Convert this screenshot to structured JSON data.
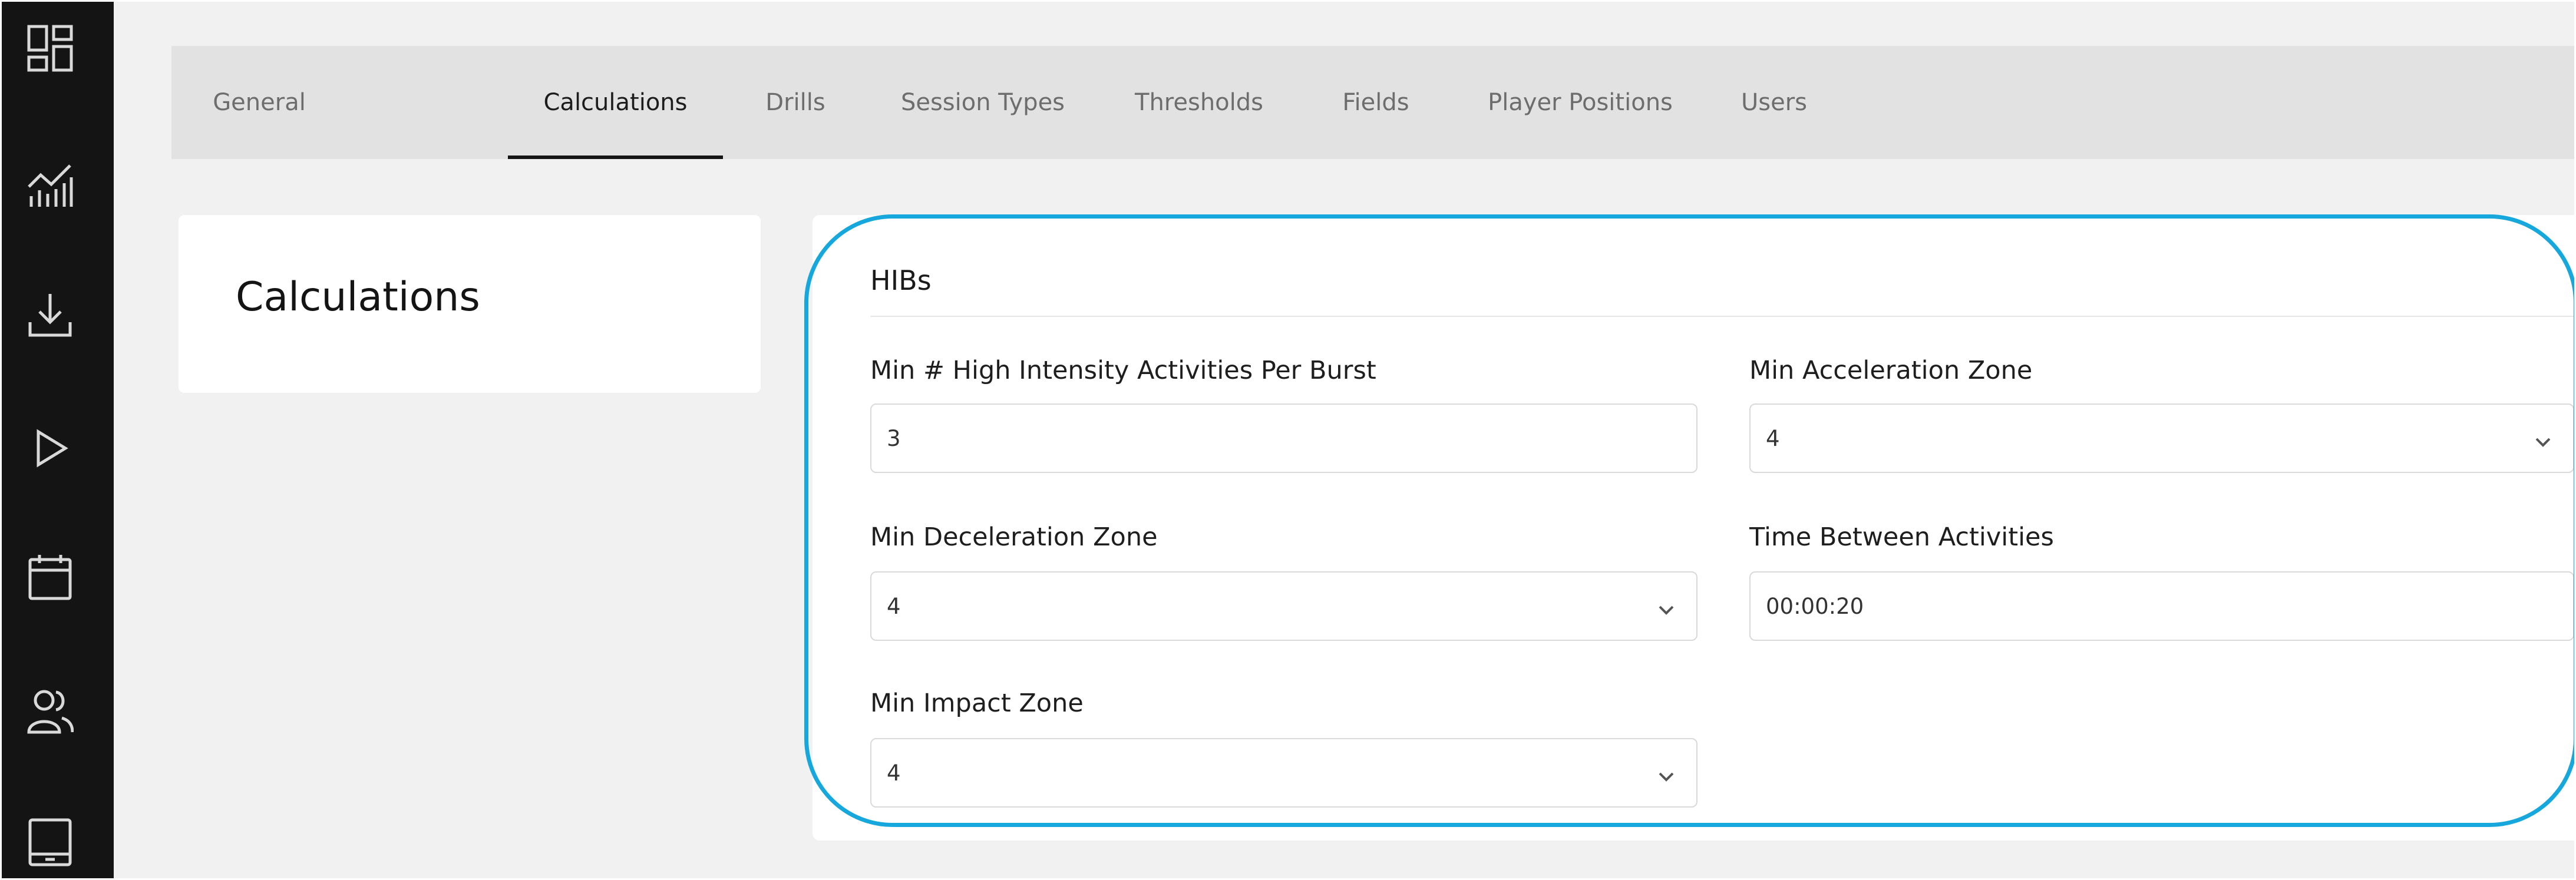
{
  "sidebar": {
    "items": [
      {
        "icon": "dashboard-icon"
      },
      {
        "icon": "analytics-icon"
      },
      {
        "icon": "download-icon"
      },
      {
        "icon": "play-icon"
      },
      {
        "icon": "calendar-icon"
      },
      {
        "icon": "users-icon"
      },
      {
        "icon": "tablet-icon"
      }
    ]
  },
  "tabs": [
    {
      "label": "General"
    },
    {
      "label": "Calculations",
      "active": true
    },
    {
      "label": "Drills"
    },
    {
      "label": "Session Types"
    },
    {
      "label": "Thresholds"
    },
    {
      "label": "Fields"
    },
    {
      "label": "Player Positions"
    },
    {
      "label": "Users"
    }
  ],
  "page": {
    "title": "Calculations"
  },
  "section": {
    "title": "HIBs",
    "fields": {
      "min_activities": {
        "label": "Min # High Intensity Activities Per Burst",
        "value": "3"
      },
      "min_accel_zone": {
        "label": "Min Acceleration Zone",
        "value": "4"
      },
      "min_decel_zone": {
        "label": "Min Deceleration Zone",
        "value": "4"
      },
      "time_between": {
        "label": "Time Between Activities",
        "value": "00:00:20"
      },
      "min_impact_zone": {
        "label": "Min Impact Zone",
        "value": "4"
      }
    }
  },
  "colors": {
    "sidebar_bg": "#141414",
    "tabbar_bg": "#e2e2e2",
    "highlight": "#16a8dd",
    "page_bg": "#f1f1f1"
  }
}
